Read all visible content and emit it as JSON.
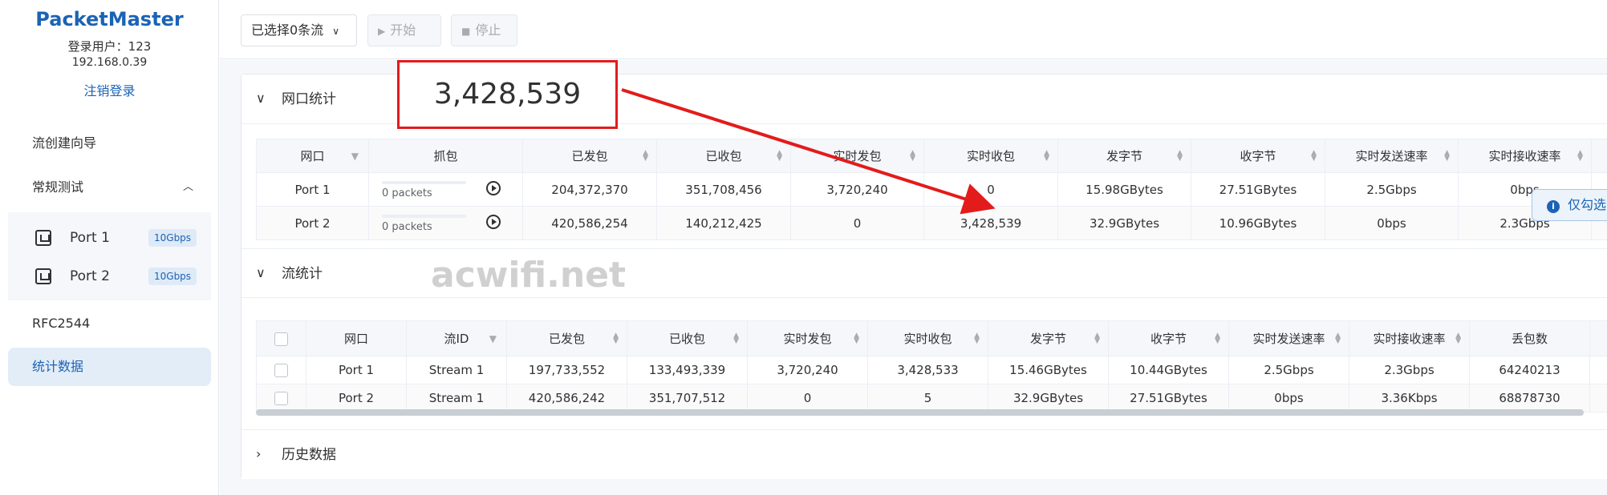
{
  "sidebar": {
    "brand": "PacketMaster",
    "user_line": "登录用户：123",
    "ip": "192.168.0.39",
    "logout": "注销登录",
    "nav": {
      "wizard": "流创建向导",
      "routine": "常规测试",
      "rfc": "RFC2544",
      "stats": "统计数据"
    },
    "ports": [
      {
        "label": "Port 1",
        "speed": "10Gbps"
      },
      {
        "label": "Port 2",
        "speed": "10Gbps"
      }
    ]
  },
  "toolbar": {
    "select_label": "已选择0条流",
    "start_label": "开始",
    "stop_label": "停止"
  },
  "port_stats": {
    "title": "网口统计",
    "headers": [
      "网口",
      "抓包",
      "已发包",
      "已收包",
      "实时发包",
      "实时收包",
      "发字节",
      "收字节",
      "实时发送速率",
      "实时接收速率"
    ],
    "rows": [
      {
        "port": "Port 1",
        "capture": "0 packets",
        "tx_pkts": "204,372,370",
        "rx_pkts": "351,708,456",
        "rt_tx": "3,720,240",
        "rt_rx": "0",
        "tx_bytes": "15.98GBytes",
        "rx_bytes": "27.51GBytes",
        "tx_rate": "2.5Gbps",
        "rx_rate": "0bps"
      },
      {
        "port": "Port 2",
        "capture": "0 packets",
        "tx_pkts": "420,586,254",
        "rx_pkts": "140,212,425",
        "rt_tx": "0",
        "rt_rx": "3,428,539",
        "tx_bytes": "32.9GBytes",
        "rx_bytes": "10.96GBytes",
        "tx_rate": "0bps",
        "rx_rate": "2.3Gbps"
      }
    ]
  },
  "stream_stats": {
    "title": "流统计",
    "only_btn": "仅勾选",
    "headers": [
      "网口",
      "流ID",
      "已发包",
      "已收包",
      "实时发包",
      "实时收包",
      "发字节",
      "收字节",
      "实时发送速率",
      "实时接收速率",
      "丢包数"
    ],
    "rows": [
      {
        "port": "Port 1",
        "stream": "Stream 1",
        "tx_pkts": "197,733,552",
        "rx_pkts": "133,493,339",
        "rt_tx": "3,720,240",
        "rt_rx": "3,428,533",
        "tx_bytes": "15.46GBytes",
        "rx_bytes": "10.44GBytes",
        "tx_rate": "2.5Gbps",
        "rx_rate": "2.3Gbps",
        "lost": "64240213"
      },
      {
        "port": "Port 2",
        "stream": "Stream 1",
        "tx_pkts": "420,586,242",
        "rx_pkts": "351,707,512",
        "rt_tx": "0",
        "rt_rx": "5",
        "tx_bytes": "32.9GBytes",
        "rx_bytes": "27.51GBytes",
        "tx_rate": "0bps",
        "rx_rate": "3.36Kbps",
        "lost": "68878730"
      }
    ]
  },
  "history": {
    "title": "历史数据"
  },
  "annotation": {
    "callout_value": "3,428,539",
    "color": "#e31b1b"
  },
  "watermark": "acwifi.net",
  "colors": {
    "brand": "#1b63b5",
    "active_bg": "#e3edf8",
    "header_bg": "#f5f7fa"
  }
}
